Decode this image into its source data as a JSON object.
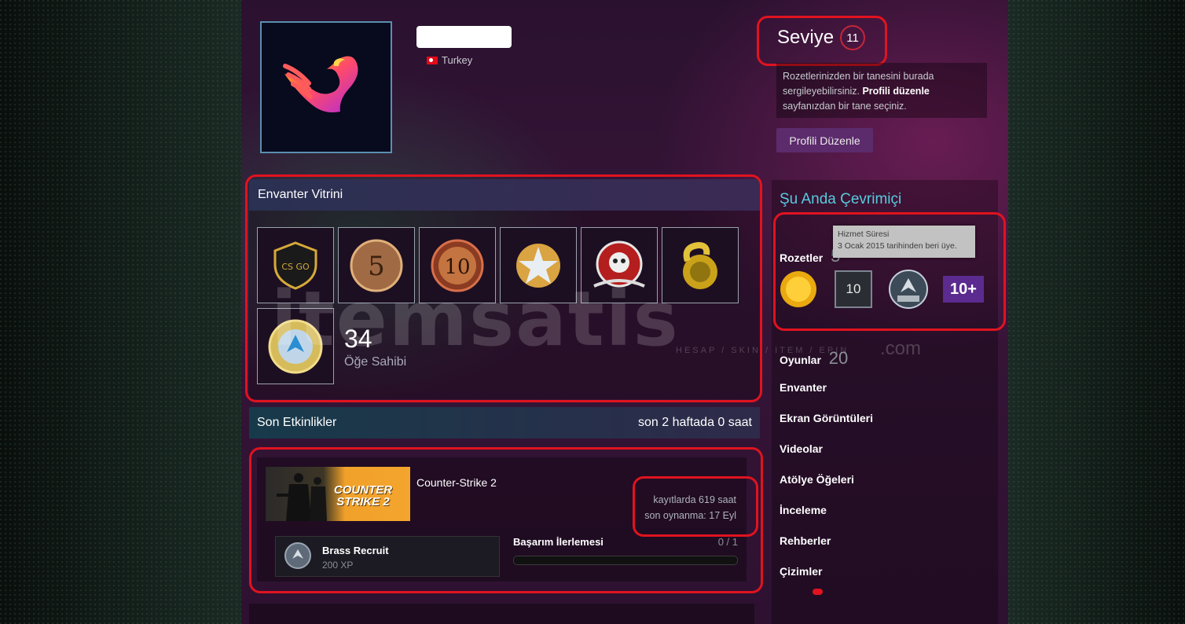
{
  "profile": {
    "country": "Turkey",
    "level_label": "Seviye",
    "level": "11",
    "badge_info_before": "Rozetlerinizden bir tanesini burada sergileyebilirsiniz.",
    "badge_info_link": "Profili düzenle",
    "badge_info_after": "sayfanızdan bir tane seçiniz.",
    "edit_button": "Profili Düzenle"
  },
  "showcase": {
    "title": "Envanter Vitrini",
    "items": [
      "csgo-badge-icon",
      "five-year-veteran-coin-icon",
      "ten-year-coin-icon",
      "star-medal-icon",
      "skull-pin-icon",
      "golden-snake-pin-icon",
      "operation-coin-icon"
    ],
    "count": "34",
    "count_label": "Öğe Sahibi"
  },
  "activity": {
    "title": "Son Etkinlikler",
    "summary": "son 2 haftada 0 saat",
    "game": {
      "name": "Counter-Strike 2",
      "capsule_text": "COUNTER STRIKE 2",
      "hours_on_record": "kayıtlarda 619 saat",
      "last_played": "son oynanma: 17 Eyl",
      "rank": "Brass Recruit",
      "xp": "200 XP",
      "achievement_title": "Başarım İlerlemesi",
      "achievement_count": "0 / 1",
      "achievement_progress": 0
    }
  },
  "sidebar": {
    "status": "Şu Anda Çevrimiçi",
    "badges_label": "Rozetler",
    "badges_count_partial": "5",
    "tooltip_title": "Hizmet Süresi",
    "tooltip_text": "3 Ocak 2015 tarihinden beri üye.",
    "badge_10": "10",
    "badge_10plus": "10+",
    "games_label": "Oyunlar",
    "games_count": "20",
    "links": [
      "Envanter",
      "Ekran Görüntüleri",
      "Videolar",
      "Atölye Öğeleri",
      "İnceleme",
      "Rehberler",
      "Çizimler"
    ]
  },
  "watermark": {
    "main": "itemsatis",
    "sub": "HESAP / SKIN / ITEM / EPIN",
    "suffix": ".com"
  },
  "colors": {
    "highlight_red": "#e0131f",
    "online_blue": "#57cbde",
    "edit_button_bg": "#5c2b6c"
  }
}
